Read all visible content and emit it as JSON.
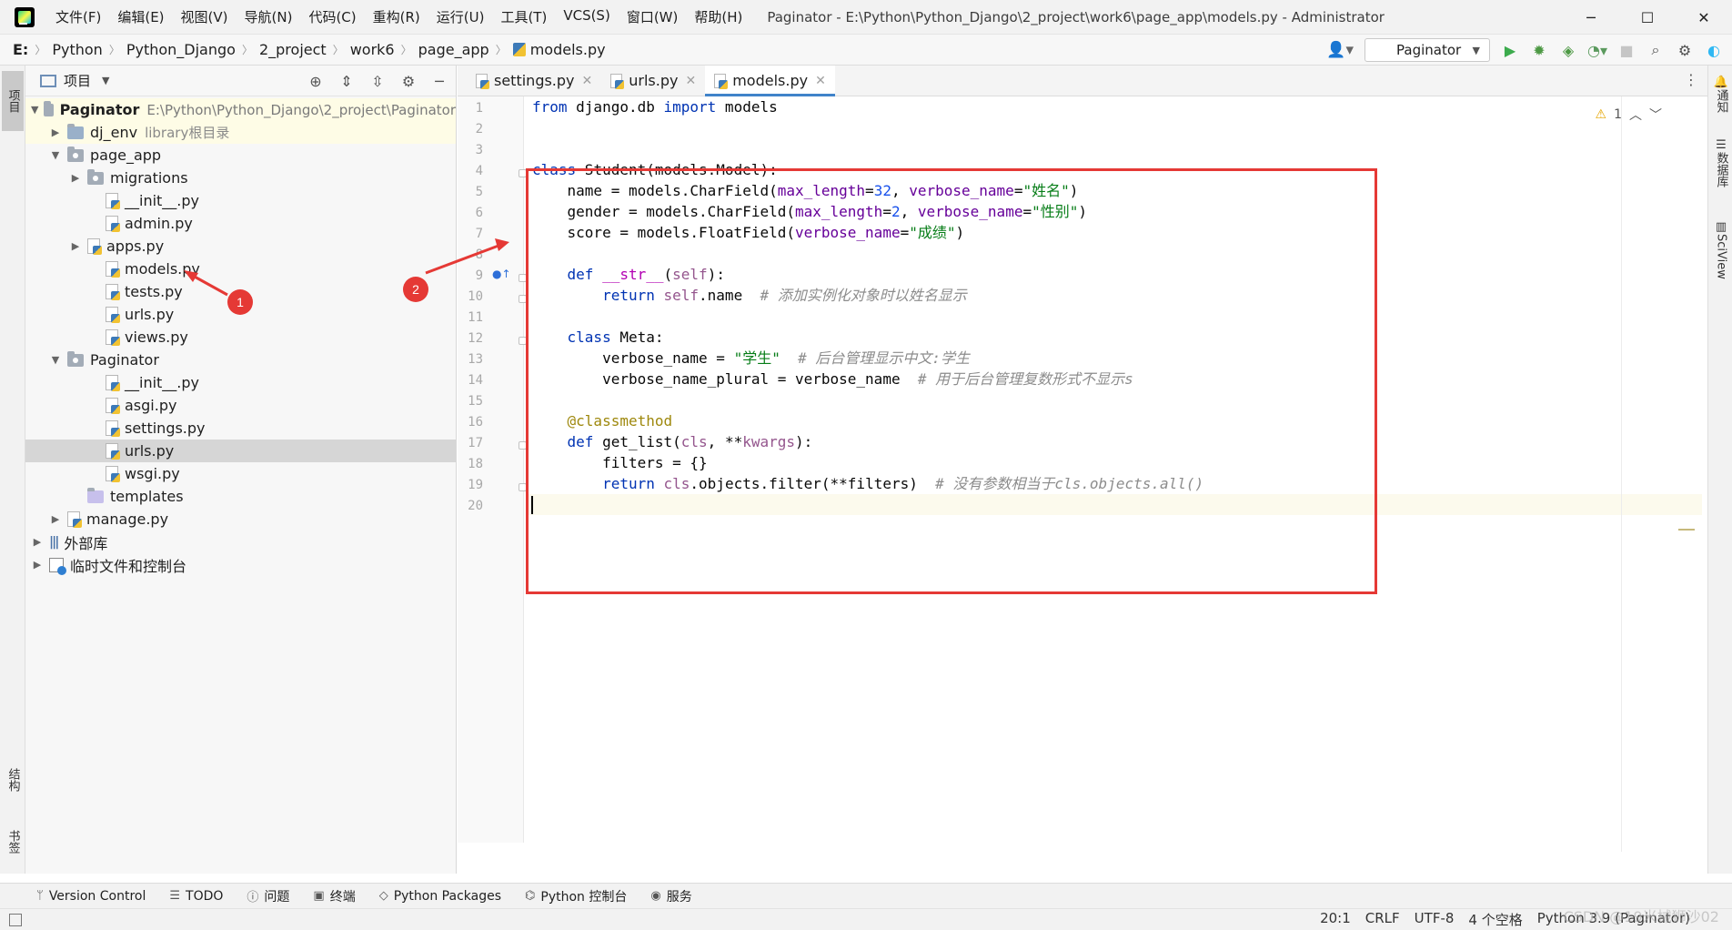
{
  "titlebar": {
    "menu": [
      "文件(F)",
      "编辑(E)",
      "视图(V)",
      "导航(N)",
      "代码(C)",
      "重构(R)",
      "运行(U)",
      "工具(T)",
      "VCS(S)",
      "窗口(W)",
      "帮助(H)"
    ],
    "title": "Paginator - E:\\Python\\Python_Django\\2_project\\work6\\page_app\\models.py - Administrator",
    "window_buttons": [
      "─",
      "☐",
      "✕"
    ]
  },
  "breadcrumb": {
    "items": [
      "E:",
      "Python",
      "Python_Django",
      "2_project",
      "work6",
      "page_app"
    ],
    "file": "models.py"
  },
  "toolbar": {
    "run_config": "Paginator"
  },
  "left_stripe": {
    "project_tab": "项目",
    "structure_tab": "结构",
    "bookmarks_tab": "书签"
  },
  "project_panel": {
    "header": "项目",
    "tree": [
      {
        "label": "Paginator",
        "extra": "E:\\Python\\Python_Django\\2_project\\Paginator"
      },
      {
        "label": "dj_env",
        "extra": "library根目录"
      },
      {
        "label": "page_app"
      },
      {
        "label": "migrations"
      },
      {
        "label": "__init__.py"
      },
      {
        "label": "admin.py"
      },
      {
        "label": "apps.py"
      },
      {
        "label": "models.py"
      },
      {
        "label": "tests.py"
      },
      {
        "label": "urls.py"
      },
      {
        "label": "views.py"
      },
      {
        "label": "Paginator"
      },
      {
        "label": "__init__.py"
      },
      {
        "label": "asgi.py"
      },
      {
        "label": "settings.py"
      },
      {
        "label": "urls.py"
      },
      {
        "label": "wsgi.py"
      },
      {
        "label": "templates"
      },
      {
        "label": "manage.py"
      },
      {
        "label": "外部库"
      },
      {
        "label": "临时文件和控制台"
      }
    ]
  },
  "annotations": {
    "badge1": "1",
    "badge2": "2"
  },
  "editor": {
    "tabs": [
      "settings.py",
      "urls.py",
      "models.py"
    ],
    "active_tab": "models.py",
    "warning_count": "1",
    "line_numbers": [
      "1",
      "2",
      "3",
      "4",
      "5",
      "6",
      "7",
      "8",
      "9",
      "10",
      "11",
      "12",
      "13",
      "14",
      "15",
      "16",
      "17",
      "18",
      "19",
      "20"
    ],
    "code": [
      "from django.db import models",
      "",
      "",
      "class Student(models.Model):",
      "    name = models.CharField(max_length=32, verbose_name=\"姓名\")",
      "    gender = models.CharField(max_length=2, verbose_name=\"性别\")",
      "    score = models.FloatField(verbose_name=\"成绩\")",
      "",
      "    def __str__(self):",
      "        return self.name  # 添加实例化对象时以姓名显示",
      "",
      "    class Meta:",
      "        verbose_name = \"学生\"  # 后台管理显示中文:学生",
      "        verbose_name_plural = verbose_name  # 用于后台管理复数形式不显示s",
      "",
      "    @classmethod",
      "    def get_list(cls, **kwargs):",
      "        filters = {}",
      "        return cls.objects.filter(**filters)  # 没有参数相当于cls.objects.all()",
      ""
    ]
  },
  "right_stripe": {
    "notifications": "通知",
    "database": "数据库",
    "sciview": "SciView"
  },
  "bottom_tools": [
    "Version Control",
    "TODO",
    "问题",
    "终端",
    "Python Packages",
    "Python 控制台",
    "服务"
  ],
  "status": {
    "position": "20:1",
    "line_sep": "CRLF",
    "encoding": "UTF-8",
    "indent": "4 个空格",
    "interpreter": "Python 3.9 (Paginator)",
    "watermark": "CSDN @19米械狮沙02"
  }
}
